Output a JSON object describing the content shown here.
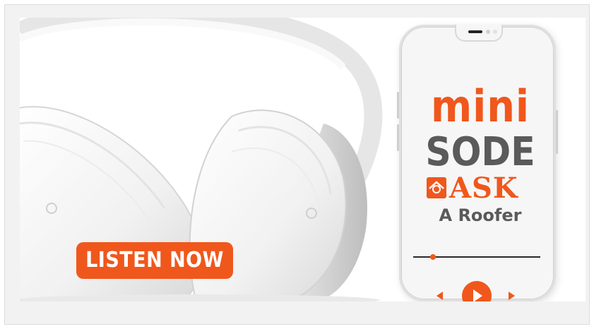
{
  "banner": {
    "cta_label": "LISTEN NOW",
    "image_subject": "headphones-icon",
    "accent_color": "#f0571c",
    "logo": {
      "line1": "mini",
      "line2": "SODE",
      "line3": "ASK",
      "line4": "A Roofer"
    },
    "player": {
      "prev": "previous-icon",
      "play": "play-icon",
      "next": "next-icon"
    }
  }
}
